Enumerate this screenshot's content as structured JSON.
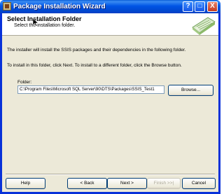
{
  "window": {
    "title": "Package Installation Wizard",
    "buttons": {
      "help": "?",
      "maximize": "□",
      "close": "X"
    }
  },
  "header": {
    "title": "Select Installation Folder",
    "subtitle": "Select the installation folder."
  },
  "body": {
    "line1": "The installer will install the SSIS packages and their dependencies in the following folder.",
    "line2": "To install in this folder, click Next. To install to a different folder, click the Browse button."
  },
  "folder": {
    "label": "Folder:",
    "value": "C:\\Program Files\\Microsoft SQL Server\\90\\DTS\\Packages\\SSIS_Test1",
    "browse_label": "Browse..."
  },
  "footer": {
    "help_label": "Help",
    "back_label": "< Back",
    "next_label": "Next >",
    "finish_label": "Finish >>|",
    "cancel_label": "Cancel"
  },
  "icons": {
    "title_icon": "package-icon",
    "header_graphic": "installer-graphic-icon",
    "cursor": "mouse-cursor-icon"
  }
}
